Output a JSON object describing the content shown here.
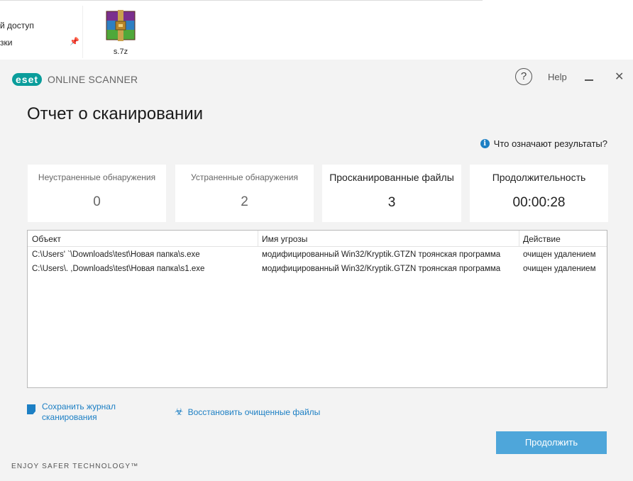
{
  "explorer": {
    "nav_items": [
      {
        "label": "й доступ"
      },
      {
        "label": "зки"
      }
    ],
    "file": {
      "name": "s.7z",
      "icon": "winrar-archive-icon"
    }
  },
  "app": {
    "brand": "eset",
    "product": "ONLINE SCANNER",
    "help_label": "Help",
    "brand_color": "#0a9d9b",
    "accent_color": "#1c7fc4"
  },
  "page": {
    "title": "Отчет о сканировании",
    "results_link": "Что означают результаты?"
  },
  "stats": [
    {
      "label": "Неустраненные обнаружения",
      "value": "0"
    },
    {
      "label": "Устраненные обнаружения",
      "value": "2"
    },
    {
      "label": "Просканированные файлы",
      "value": "3"
    },
    {
      "label": "Продолжительность",
      "value": "00:00:28"
    }
  ],
  "table": {
    "columns": [
      "Объект",
      "Имя угрозы",
      "Действие"
    ],
    "rows": [
      [
        "C:\\Users'        `\\Downloads\\test\\Новая папка\\s.exe",
        "модифицированный Win32/Kryptik.GTZN троянская программа",
        "очищен удалением"
      ],
      [
        "C:\\Users\\.        ,Downloads\\test\\Новая папка\\s1.exe",
        "модифицированный Win32/Kryptik.GTZN троянская программа",
        "очищен удалением"
      ]
    ]
  },
  "actions": {
    "save_log_line1": "Сохранить журнал",
    "save_log_line2": "сканирования",
    "restore_files": "Восстановить очищенные файлы",
    "continue": "Продолжить"
  },
  "footer": "ENJOY SAFER TECHNOLOGY™"
}
